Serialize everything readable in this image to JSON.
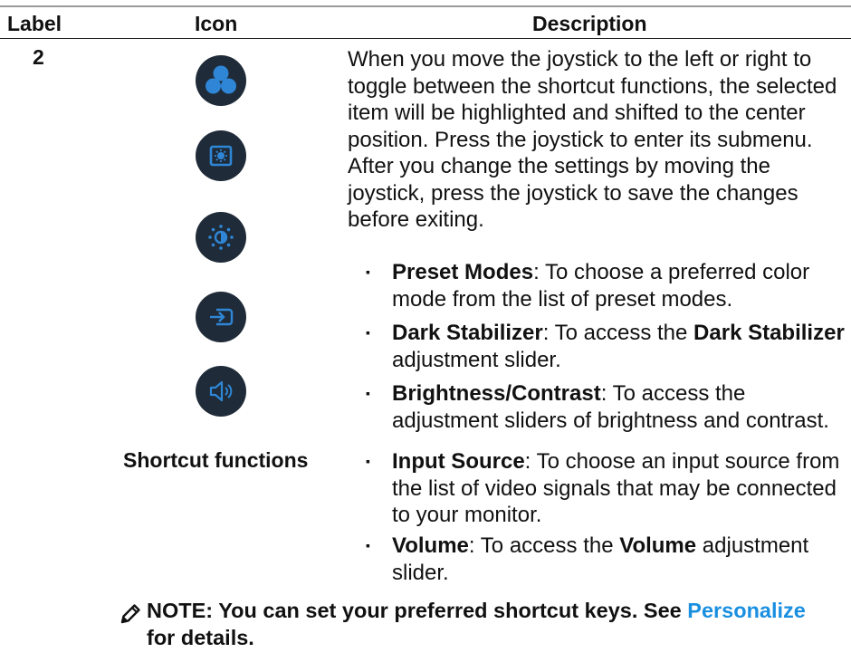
{
  "table": {
    "headers": {
      "label": "Label",
      "icon": "Icon",
      "description": "Description"
    },
    "row": {
      "label": "2",
      "icons": [
        {
          "name": "preset-modes-icon",
          "color": "#1f2b38"
        },
        {
          "name": "dark-stabilizer-icon",
          "color": "#1f2b38"
        },
        {
          "name": "brightness-contrast-icon",
          "color": "#1f2b38"
        },
        {
          "name": "input-source-icon",
          "color": "#1f2b38"
        },
        {
          "name": "volume-icon",
          "color": "#1f2b38"
        }
      ],
      "icon_caption": "Shortcut functions",
      "description": "When you move the joystick to the left or right to toggle between the shortcut functions, the selected item will be highlighted and shifted to the center position. Press the joystick to enter its submenu. After you change the settings by moving the joystick, press the joystick to save the changes before exiting.",
      "bullet_marker": "▪",
      "bullets": [
        {
          "term": "Preset Modes",
          "text": ": To choose a preferred color mode from the list of preset modes."
        },
        {
          "term": "Dark Stabilizer",
          "text_before": ": To access the ",
          "bold_inline": "Dark Stabilizer",
          "text_after": " adjustment slider."
        },
        {
          "term": "Brightness/Contrast",
          "text": ": To access the adjustment sliders of brightness and contrast."
        },
        {
          "term": "Input Source",
          "text": ": To choose an input source from the list of video signals that may be connected to your monitor."
        },
        {
          "term": "Volume",
          "text_before": ": To access the ",
          "bold_inline": "Volume",
          "text_after": " adjustment slider."
        }
      ]
    }
  },
  "note": {
    "prefix": "NOTE: You can set your preferred shortcut keys. See ",
    "link": "Personalize",
    "suffix": " for details.",
    "link_color": "#1a8fe0"
  }
}
